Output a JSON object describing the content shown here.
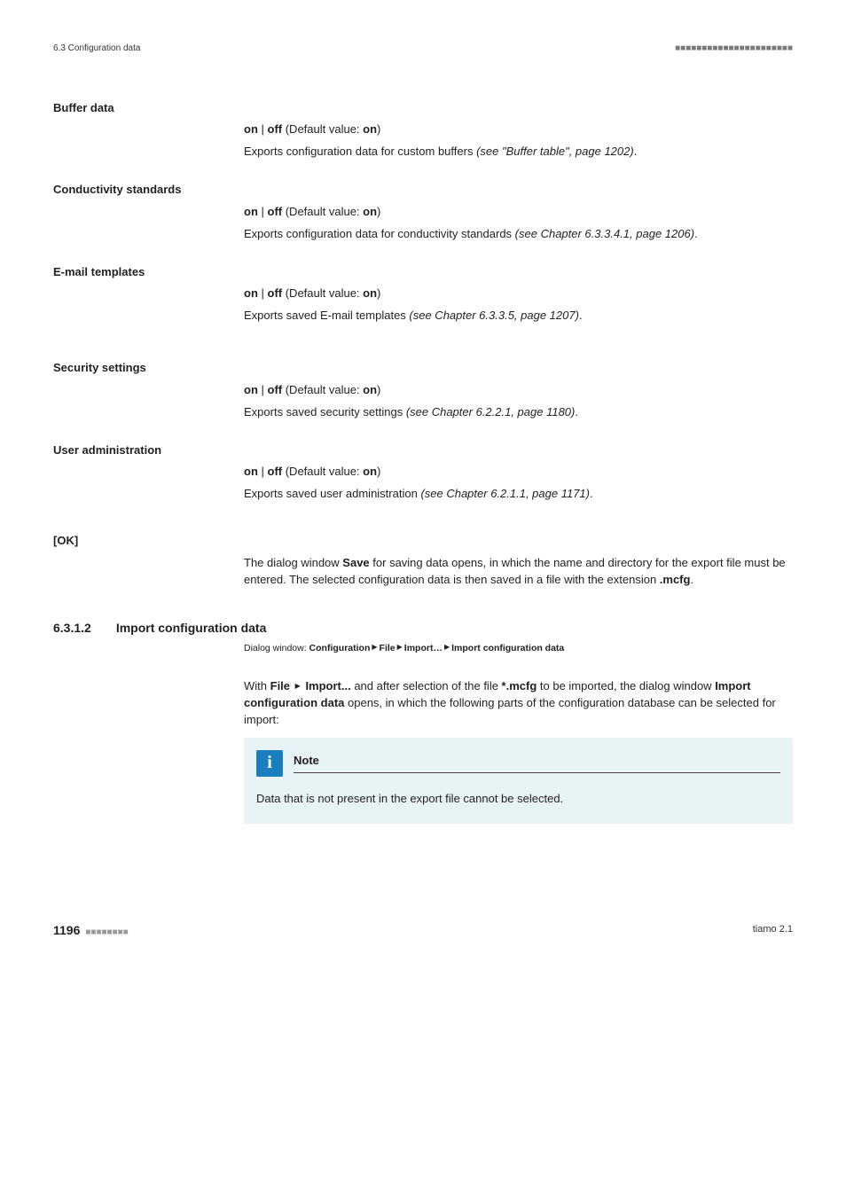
{
  "header": {
    "left": "6.3 Configuration data",
    "ticks": "■■■■■■■■■■■■■■■■■■■■■■"
  },
  "sections": {
    "buffer": {
      "label": "Buffer data",
      "toggle": {
        "on": "on",
        "sep": " | ",
        "off": "off",
        "dlabel": " (Default value: ",
        "dval": "on",
        "dclose": ")"
      },
      "desc_pre": "Exports configuration data for custom buffers ",
      "desc_italic": "(see \"Buffer table\", page 1202)",
      "desc_post": "."
    },
    "cond": {
      "label": "Conductivity standards",
      "toggle": {
        "on": "on",
        "sep": " | ",
        "off": "off",
        "dlabel": " (Default value: ",
        "dval": "on",
        "dclose": ")"
      },
      "desc_pre": "Exports configuration data for conductivity standards ",
      "desc_italic": "(see Chapter 6.3.3.4.1, page 1206)",
      "desc_post": "."
    },
    "email": {
      "label": "E-mail templates",
      "toggle": {
        "on": "on",
        "sep": " | ",
        "off": "off",
        "dlabel": " (Default value: ",
        "dval": "on",
        "dclose": ")"
      },
      "desc_pre": "Exports saved E-mail templates ",
      "desc_italic": "(see Chapter 6.3.3.5, page 1207)",
      "desc_post": "."
    },
    "security": {
      "label": "Security settings",
      "toggle": {
        "on": "on",
        "sep": " | ",
        "off": "off",
        "dlabel": " (Default value: ",
        "dval": "on",
        "dclose": ")"
      },
      "desc_pre": "Exports saved security settings ",
      "desc_italic": "(see Chapter 6.2.2.1, page 1180)",
      "desc_post": "."
    },
    "useradmin": {
      "label": "User administration",
      "toggle": {
        "on": "on",
        "sep": " | ",
        "off": "off",
        "dlabel": " (Default value: ",
        "dval": "on",
        "dclose": ")"
      },
      "desc_pre": "Exports saved user administration ",
      "desc_italic": "(see Chapter 6.2.1.1, page 1171)",
      "desc_post": "."
    },
    "ok": {
      "label": "[OK]",
      "desc_1a": "The dialog window ",
      "desc_1b_bold": "Save",
      "desc_1c": " for saving data opens, in which the name and directory for the export file must be entered. The selected configuration data is then saved in a file with the extension ",
      "desc_1d_bold": ".mcfg",
      "desc_1e": "."
    }
  },
  "subsection": {
    "num": "6.3.1.2",
    "title": "Import configuration data",
    "path_label": "Dialog window: ",
    "path_parts": [
      "Configuration",
      "File",
      "Import…",
      "Import configuration data"
    ],
    "para_1a": "With ",
    "para_1b_bold": "File",
    "para_1c": " ",
    "para_1d_bold": "Import...",
    "para_1e": " and after selection of the file ",
    "para_1f_bold": "*.mcfg",
    "para_1g": " to be imported, the dialog window ",
    "para_1h_bold": "Import configuration data",
    "para_1i": " opens, in which the following parts of the configuration database can be selected for import:"
  },
  "note": {
    "icon": "i",
    "label": "Note",
    "body": "Data that is not present in the export file cannot be selected."
  },
  "footer": {
    "page": "1196",
    "ticks": "■■■■■■■■",
    "right": "tiamo 2.1"
  },
  "tri": "▶"
}
